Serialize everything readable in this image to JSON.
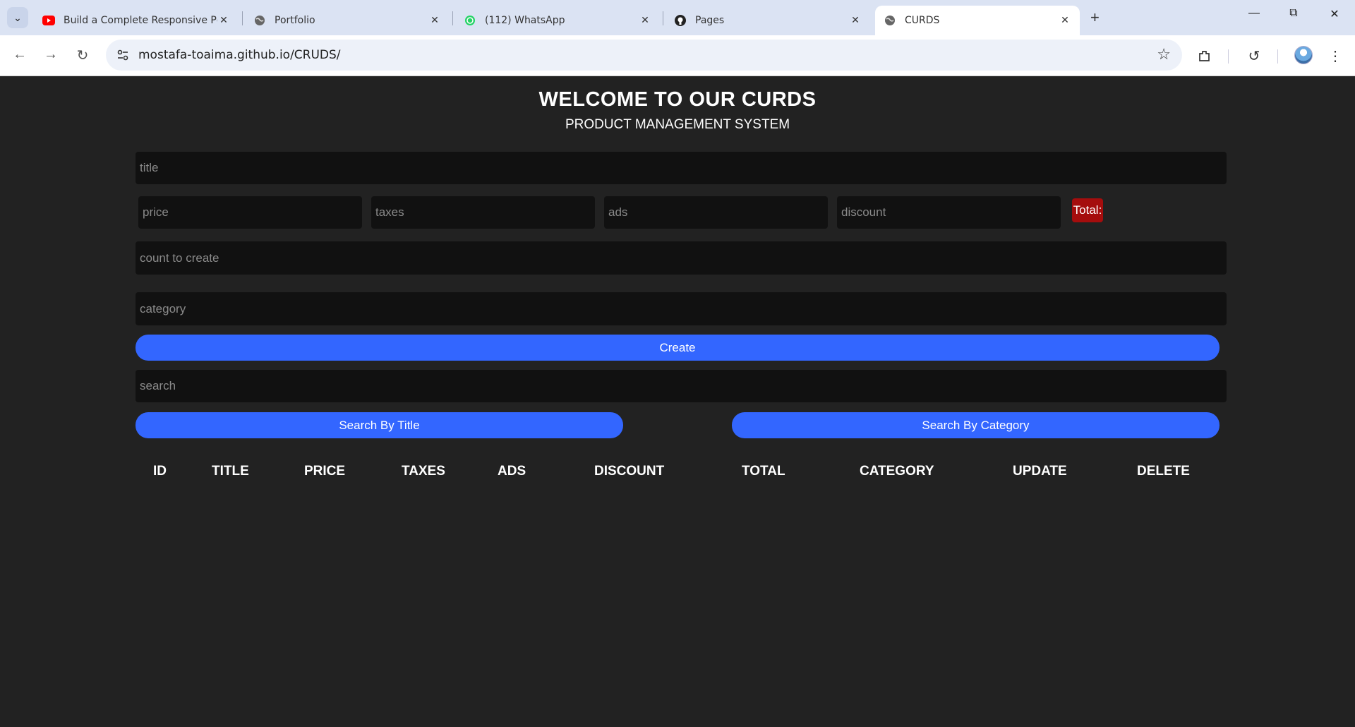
{
  "browser": {
    "tabs": [
      {
        "title": "Build a Complete Responsive Pc",
        "icon": "youtube-icon",
        "color": "#ff0000"
      },
      {
        "title": "Portfolio",
        "icon": "globe-icon"
      },
      {
        "title": "(112) WhatsApp",
        "icon": "whatsapp-icon",
        "color": "#25d366"
      },
      {
        "title": "Pages",
        "icon": "github-icon"
      },
      {
        "title": "CURDS",
        "icon": "globe-icon",
        "active": true
      }
    ],
    "url": "mostafa-toaima.github.io/CRUDS/"
  },
  "header": {
    "title": "WELCOME TO OUR CURDS",
    "subtitle": "PRODUCT MANAGEMENT SYSTEM"
  },
  "form": {
    "title_placeholder": "title",
    "price_placeholder": "price",
    "taxes_placeholder": "taxes",
    "ads_placeholder": "ads",
    "discount_placeholder": "discount",
    "total_label": "Total:",
    "count_placeholder": "count to create",
    "category_placeholder": "category",
    "create_label": "Create"
  },
  "search": {
    "placeholder": "search",
    "by_title_label": "Search By Title",
    "by_category_label": "Search By Category"
  },
  "table": {
    "headers": [
      "ID",
      "TITLE",
      "PRICE",
      "TAXES",
      "ADS",
      "DISCOUNT",
      "TOTAL",
      "CATEGORY",
      "UPDATE",
      "DELETE"
    ]
  },
  "colors": {
    "background": "#222222",
    "input": "#111111",
    "button": "#3366ff",
    "total_badge": "#a50d0d"
  }
}
